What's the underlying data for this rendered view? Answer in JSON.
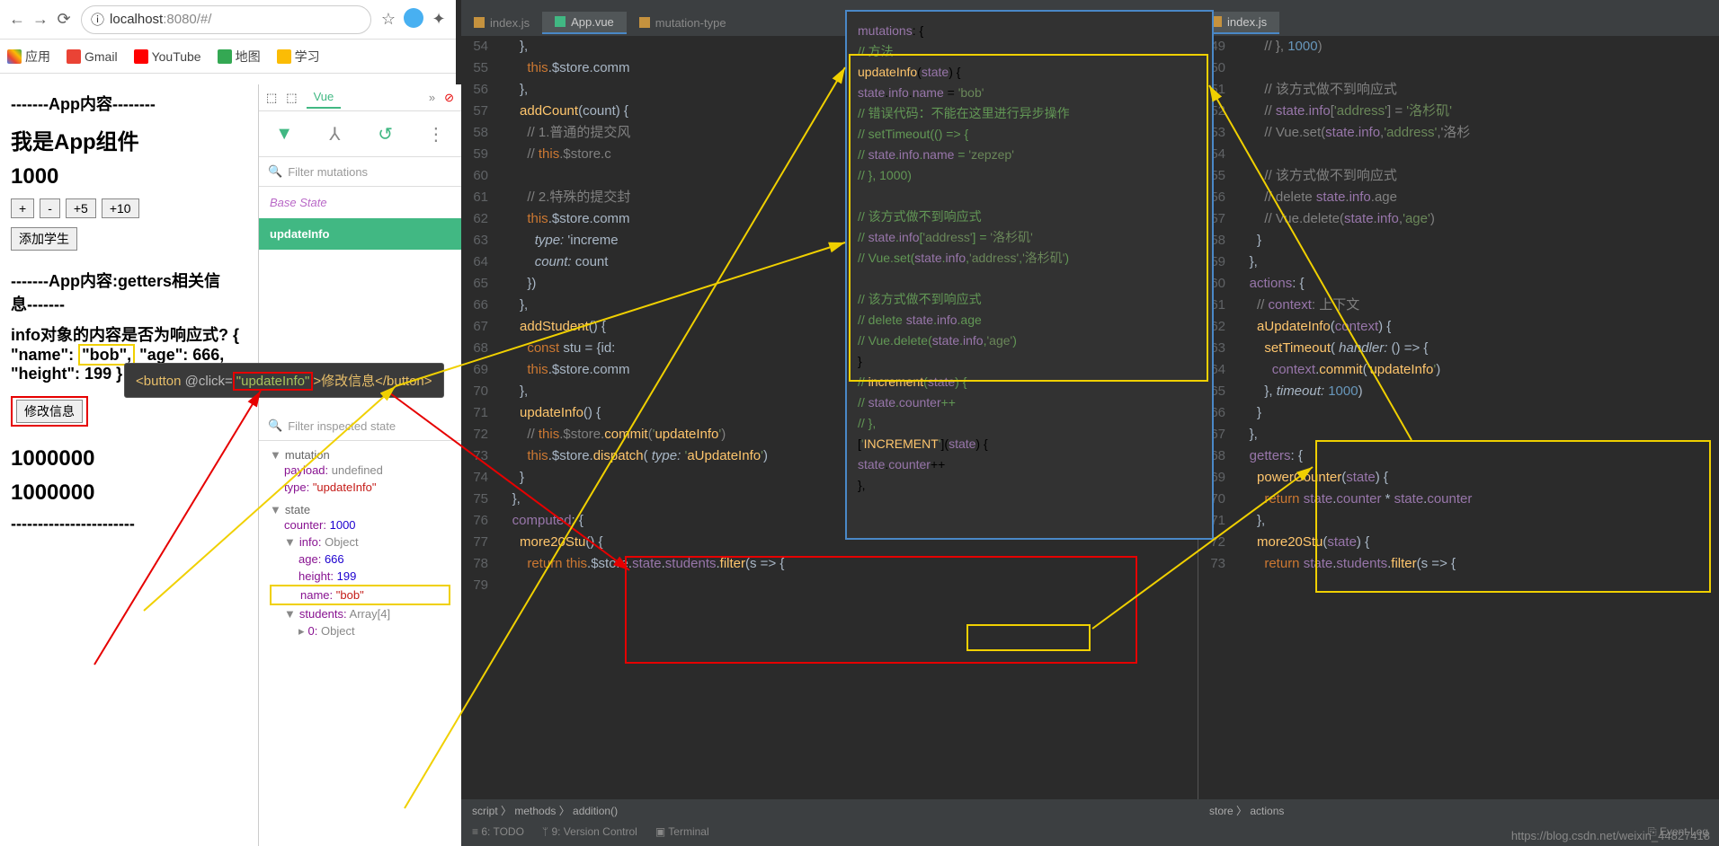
{
  "browser": {
    "url_prefix": "localhost",
    "url_suffix": ":8080/#/",
    "bookmarks": [
      {
        "label": "应用",
        "color": "#4285f4"
      },
      {
        "label": "Gmail",
        "color": "#ea4335"
      },
      {
        "label": "YouTube",
        "color": "#ff0000"
      },
      {
        "label": "地图",
        "color": "#34a853"
      },
      {
        "label": "学习",
        "color": "#fbbc05"
      }
    ]
  },
  "app": {
    "h1": "-------App内容--------",
    "h2": "我是App组件",
    "counter": "1000",
    "buttons": [
      "+",
      "-",
      "+5",
      "+10"
    ],
    "add_student": "添加学生",
    "h3": "-------App内容:getters相关信息-------",
    "info_q": "info对象的内容是否为响应式? { \"name\": ",
    "info_name": "\"bob\",",
    "info_rest": " \"age\": 666, \"height\": 199 }",
    "modify_btn": "修改信息",
    "big1": "1000000",
    "big2": "1000000"
  },
  "tooltip": {
    "open": "<button ",
    "attr": "@click=",
    "val": "\"updateInfo\"",
    "close": ">修改信息</button>"
  },
  "devtools": {
    "tab": "Vue",
    "filter_mut": "Filter mutations",
    "base": "Base State",
    "mutation": "updateInfo",
    "filter_state": "Filter inspected state",
    "sec_mut": "mutation",
    "payload_k": "payload:",
    "payload_v": "undefined",
    "type_k": "type:",
    "type_v": "\"updateInfo\"",
    "sec_state": "state",
    "counter_k": "counter:",
    "counter_v": "1000",
    "info_k": "info:",
    "info_v": "Object",
    "age_k": "age:",
    "age_v": "666",
    "height_k": "height:",
    "height_v": "199",
    "name_k": "name:",
    "name_v": "\"bob\"",
    "students_k": "students:",
    "students_v": "Array[4]",
    "zero_k": "0:",
    "zero_v": "Object"
  },
  "ide": {
    "tabs_left": [
      {
        "name": "index.js",
        "active": false,
        "icon": "#c5923e"
      },
      {
        "name": "App.vue",
        "active": true,
        "icon": "#41b883"
      },
      {
        "name": "mutation-type",
        "active": false,
        "icon": "#c5923e"
      }
    ],
    "tabs_right": [
      {
        "name": "index.js",
        "active": true,
        "icon": "#c5923e"
      }
    ],
    "gutter_left": [
      "54",
      "55",
      "56",
      "57",
      "58",
      "59",
      "60",
      "61",
      "62",
      "63",
      "64",
      "65",
      "66",
      "67",
      "68",
      "69",
      "70",
      "71",
      "72",
      "73",
      "74",
      "75",
      "76",
      "77",
      "78",
      "79"
    ],
    "gutter_right": [
      "49",
      "50",
      "51",
      "52",
      "53",
      "54",
      "55",
      "56",
      "57",
      "58",
      "59",
      "60",
      "61",
      "62",
      "63",
      "64",
      "65",
      "66",
      "67",
      "68",
      "69",
      "70",
      "71",
      "72",
      "73"
    ],
    "bc_left": "script 〉 methods 〉 addition()",
    "bc_right": "store 〉 actions",
    "footer": [
      "≡ 6: TODO",
      "ᛘ 9: Version Control",
      "▣ Terminal"
    ],
    "footer_right": "⎘ Event Log"
  },
  "code_left": [
    "      },",
    "        this.$store.comm",
    "      },",
    "      addCount(count) {",
    "        // 1.普通的提交风",
    "        // this.$store.c",
    "",
    "        // 2.特殊的提交封",
    "        this.$store.comm",
    "          type: 'increme",
    "          count: count",
    "        })",
    "      },",
    "      addStudent() {",
    "        const stu = {id:",
    "        this.$store.comm",
    "      },",
    "      updateInfo() {",
    "        // this.$store.commit('updateInfo')",
    "        this.$store.dispatch( type: 'aUpdateInfo')",
    "      }",
    "    },",
    "    computed: {",
    "      more20Stu() {",
    "        return this.$store.state.students.filter(s => {"
  ],
  "code_right": [
    "        // }, 1000)",
    "",
    "        // 该方式做不到响应式",
    "        // state.info['address'] = '洛杉矶'",
    "        // Vue.set(state.info,'address','洛杉",
    "",
    "        // 该方式做不到响应式",
    "        // delete state.info.age",
    "        // Vue.delete(state.info,'age')",
    "      }",
    "    },",
    "    actions: {",
    "      // context: 上下文",
    "      aUpdateInfo(context) {",
    "        setTimeout( handler: () => {",
    "          context.commit('updateInfo')",
    "        }, timeout: 1000)",
    "      }",
    "    },",
    "    getters: {",
    "      powerCounter(state) {",
    "        return state.counter * state.counter",
    "      },",
    "      more20Stu(state) {",
    "        return state.students.filter(s => {"
  ],
  "popup": [
    "mutations: {",
    "  // 方法",
    "  updateInfo(state) {",
    "    state.info.name = 'bob'",
    "    // 错误代码：不能在这里进行异步操作",
    "    // setTimeout(() => {",
    "    //   state.info.name = 'zepzep'",
    "    // }, 1000)",
    "",
    "    // 该方式做不到响应式",
    "    // state.info['address'] = '洛杉矶'",
    "    // Vue.set(state.info,'address','洛杉矶')",
    "",
    "    // 该方式做不到响应式",
    "    // delete state.info.age",
    "    // Vue.delete(state.info,'age')",
    "  }",
    "  // increment(state) {",
    "  //   state.counter++",
    "  // },",
    "  ['INCREMENT'](state) {",
    "    state.counter++",
    "  },"
  ],
  "watermark": "https://blog.csdn.net/weixin_44827418"
}
